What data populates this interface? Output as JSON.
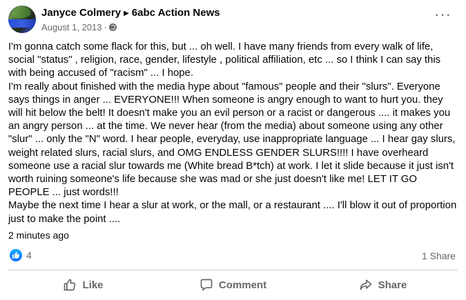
{
  "post": {
    "author": "Janyce Colmery",
    "page": "6abc Action News",
    "date": "August 1, 2013",
    "dot": "·",
    "more_label": "···",
    "paragraphs": [
      "I'm gonna catch some flack for this, but ... oh well. I have many friends from every walk of life, social \"status\" , religion, race, gender, lifestyle , political affiliation, etc ... so I think I can say this with being accused of \"racism\" ... I hope.",
      " I'm really about finished with the media hype about \"famous\" people and their \"slurs\". Everyone says things in anger ... EVERYONE!!! When someone is angry enough to want to hurt you. they will hit below the belt! It doesn't make you an evil person or a racist or dangerous .... it makes you an angry person ... at the time. We never hear (from the media) about someone using any other \"slur\" ... only the \"N\" word. I hear people, everyday, use inappropriate language ... I hear gay slurs, weight related slurs, racial slurs, and OMG ENDLESS GENDER SLURS!!!! I have overheard someone use a racial slur towards me (White bread B*tch) at work. I let it slide because it just isn't worth ruining someone's life because she was mad or she just doesn't like me! LET IT GO PEOPLE ... just words!!!",
      " Maybe the next time I hear a slur at work, or the mall, or a restaurant .... I'll blow it out of proportion just to make the point ...."
    ],
    "timestamp": "2 minutes ago",
    "reaction_count": "4",
    "share_count": "1 Share"
  },
  "actions": {
    "like": "Like",
    "comment": "Comment",
    "share": "Share"
  },
  "icons": {
    "avatar": "avatar",
    "arrow": "right-triangle-icon",
    "privacy": "globe-icon",
    "reaction": "like-reaction-icon",
    "like": "thumbs-up-icon",
    "comment": "speech-bubble-icon",
    "share": "share-arrow-icon"
  },
  "colors": {
    "text": "#050505",
    "secondary": "#65676b",
    "like_blue": "#0566ff",
    "divider": "#ced0d4"
  }
}
